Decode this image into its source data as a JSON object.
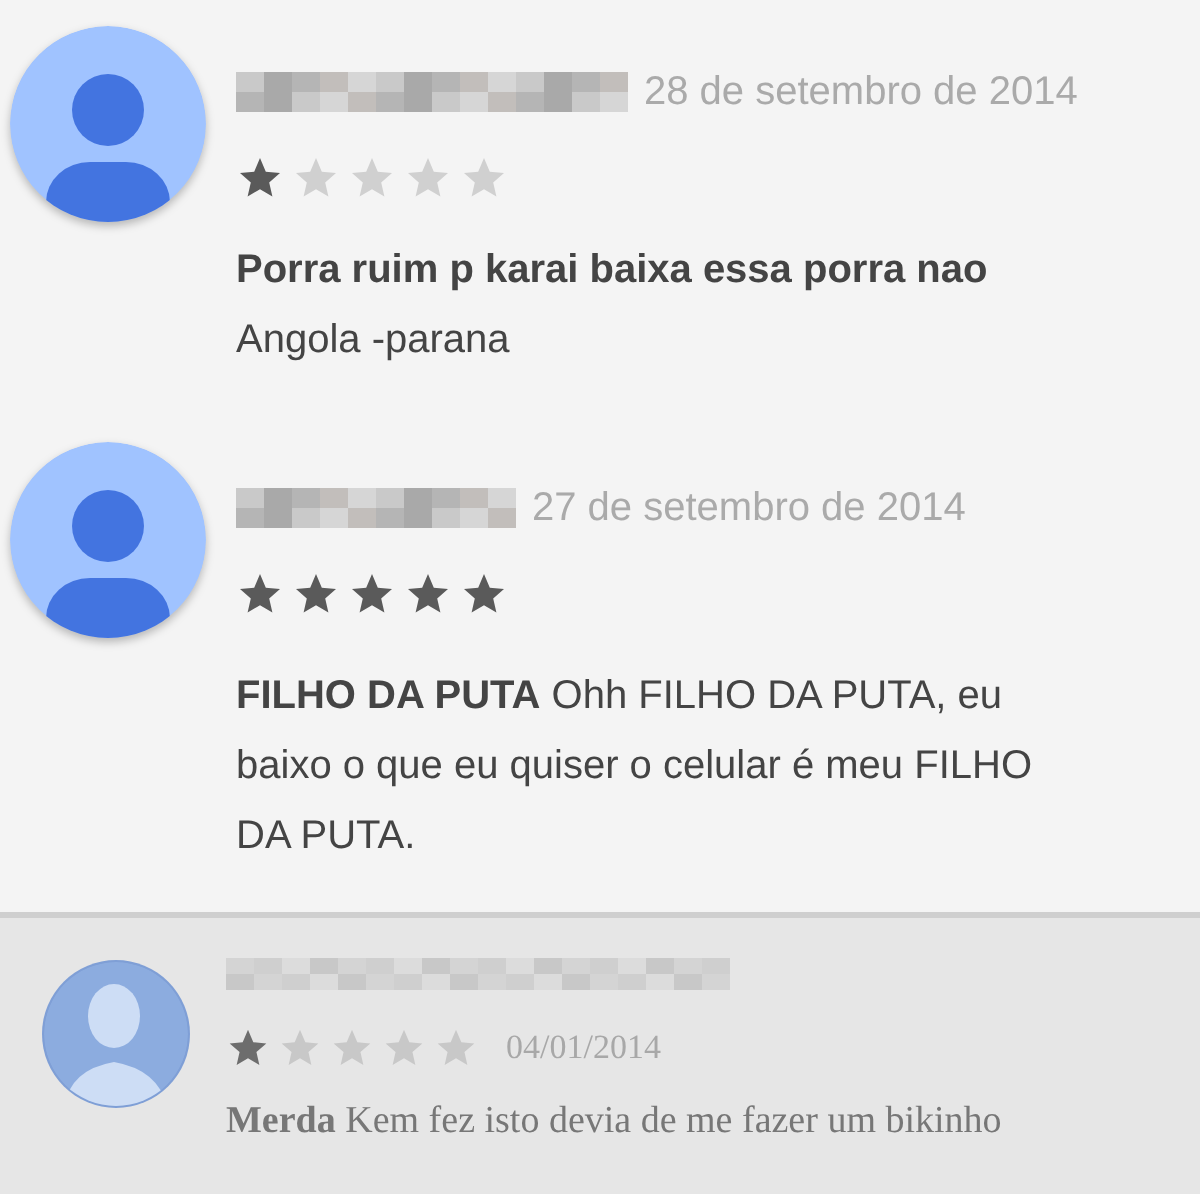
{
  "reviews": [
    {
      "kind": "modern",
      "date": "28 de setembro de 2014",
      "stars": 1,
      "title": "Porra ruim p karai baixa essa porra nao",
      "body": "Angola -parana"
    },
    {
      "kind": "modern",
      "date": "27 de setembro de 2014",
      "stars": 5,
      "body": "**FILHO DA PUTA** Ohh FILHO DA PUTA, eu baixo o que eu quiser o celular é meu FILHO DA PUTA."
    },
    {
      "kind": "classic",
      "date": "04/01/2014",
      "stars": 1,
      "body": "**Merda** Kem fez isto devia de me fazer um bikinho"
    }
  ]
}
